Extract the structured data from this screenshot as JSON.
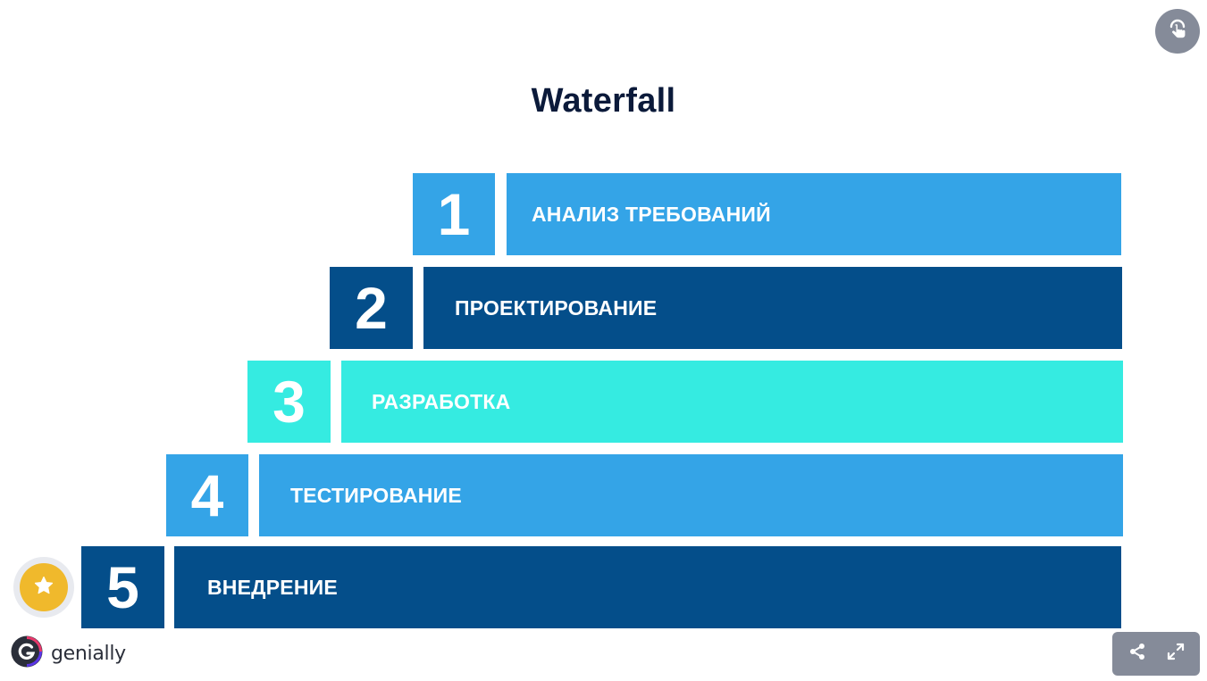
{
  "title": "Waterfall",
  "steps": [
    {
      "number": "1",
      "label": "АНАЛИЗ ТРЕБОВАНИЙ",
      "color": "#34a4e7"
    },
    {
      "number": "2",
      "label": "ПРОЕКТИРОВАНИЕ",
      "color": "#044e8a"
    },
    {
      "number": "3",
      "label": "РАЗРАБОТКА",
      "color": "#35ebe1"
    },
    {
      "number": "4",
      "label": "ТЕСТИРОВАНИЕ",
      "color": "#34a4e7"
    },
    {
      "number": "5",
      "label": "ВНЕДРЕНИЕ",
      "color": "#044e8a"
    }
  ],
  "brand": {
    "name": "genially",
    "logo_icon": "genially-logo-icon"
  },
  "controls": {
    "top_right_icon": "hand-pointer-icon",
    "badge_icon": "star-icon",
    "share_icon": "share-icon",
    "fullscreen_icon": "expand-icon"
  },
  "colors": {
    "title": "#0b1a3a",
    "light_blue": "#34a4e7",
    "dark_blue": "#044e8a",
    "turquoise": "#35ebe1",
    "control_gray": "#858b99",
    "badge_yellow": "#f0b92c"
  }
}
